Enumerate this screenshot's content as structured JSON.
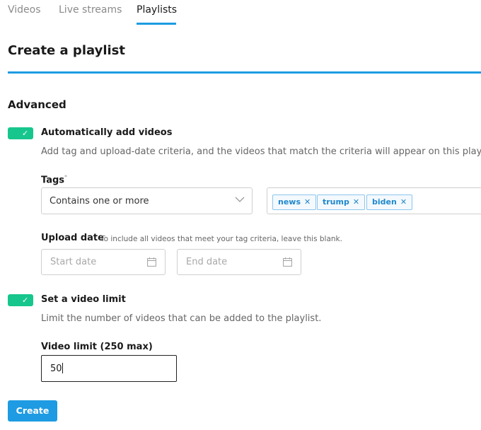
{
  "tabs": [
    {
      "label": "Videos",
      "active": false
    },
    {
      "label": "Live streams",
      "active": false
    },
    {
      "label": "Playlists",
      "active": true
    }
  ],
  "page_title": "Create a playlist",
  "section_title": "Advanced",
  "auto_add": {
    "enabled": true,
    "label": "Automatically add videos",
    "description": "Add tag and upload-date criteria, and the videos that match the criteria will appear on this playlist."
  },
  "tags": {
    "label": "Tags",
    "required_marker": "*",
    "match_mode": "Contains one or more",
    "items": [
      "news",
      "trump",
      "biden"
    ]
  },
  "upload_date": {
    "label": "Upload date",
    "help": "To include all videos that meet your tag criteria, leave this blank.",
    "start_placeholder": "Start date",
    "end_placeholder": "End date"
  },
  "video_limit": {
    "enabled": true,
    "toggle_label": "Set a video limit",
    "description": "Limit the number of videos that can be added to the playlist.",
    "field_label": "Video limit (250 max)",
    "value": "50"
  },
  "create_button": "Create",
  "colors": {
    "accent": "#1e9be2",
    "toggle_on": "#17c68c",
    "tag_text": "#2088cc"
  }
}
